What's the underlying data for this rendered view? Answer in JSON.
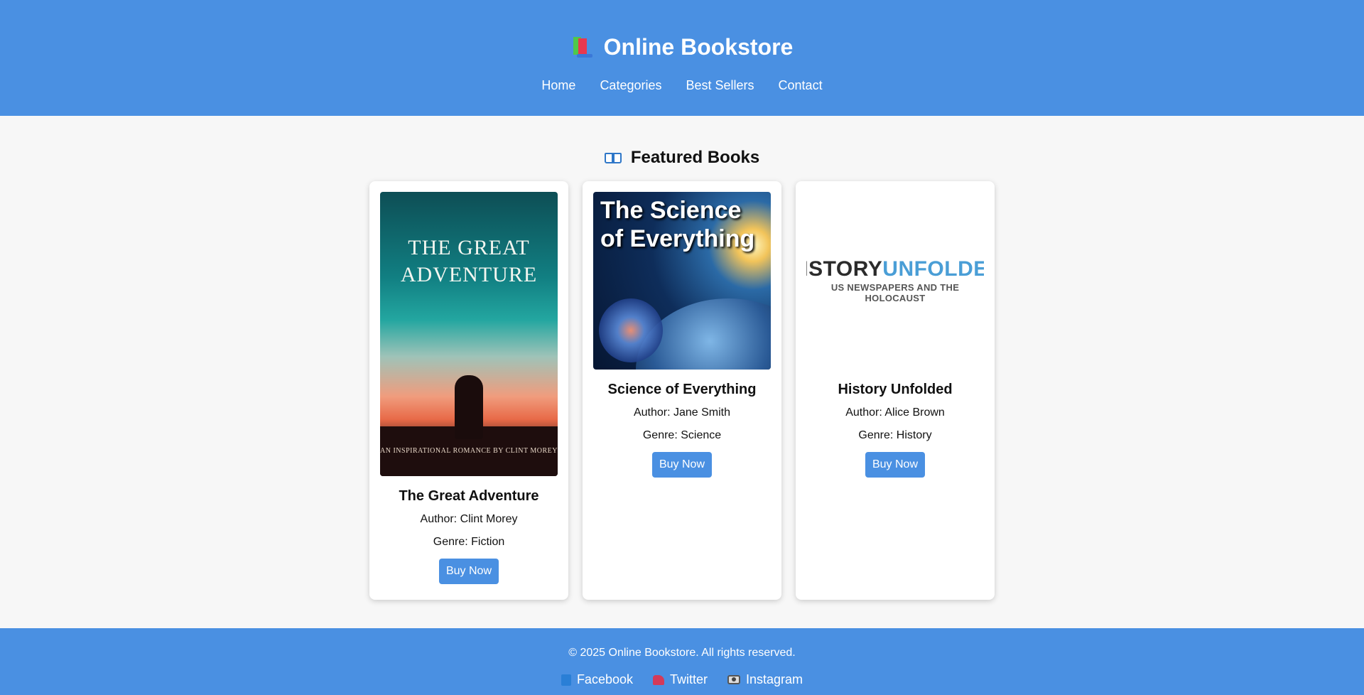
{
  "header": {
    "title": "Online Bookstore",
    "logo_icon": "books-icon",
    "nav": [
      {
        "label": "Home"
      },
      {
        "label": "Categories"
      },
      {
        "label": "Best Sellers"
      },
      {
        "label": "Contact"
      }
    ]
  },
  "main": {
    "section_icon": "open-book-icon",
    "section_title": "Featured Books",
    "books": [
      {
        "title": "The Great Adventure",
        "author": "Author: Clint Morey",
        "genre": "Genre: Fiction",
        "button": "Buy Now",
        "cover": {
          "art_title": "The Great Adventure",
          "byline": "AN INSPIRATIONAL ROMANCE BY CLINT MOREY"
        }
      },
      {
        "title": "Science of Everything",
        "author": "Author: Jane Smith",
        "genre": "Genre: Science",
        "button": "Buy Now",
        "cover": {
          "art_title": "The Science of Everything"
        }
      },
      {
        "title": "History Unfolded",
        "author": "Author: Alice Brown",
        "genre": "Genre: History",
        "button": "Buy Now",
        "cover": {
          "logo_word1": "HISTORY",
          "logo_word2": "UNFOLDED",
          "logo_sub": "US NEWSPAPERS AND THE HOLOCAUST"
        }
      }
    ]
  },
  "footer": {
    "copyright": "© 2025 Online Bookstore. All rights reserved.",
    "social": [
      {
        "label": "Facebook",
        "icon": "facebook-icon"
      },
      {
        "label": "Twitter",
        "icon": "twitter-icon"
      },
      {
        "label": "Instagram",
        "icon": "instagram-icon"
      }
    ]
  },
  "colors": {
    "brand": "#4a90e2",
    "background": "#f7f7f7",
    "card": "#ffffff",
    "history_accent": "#4a9ed6"
  }
}
